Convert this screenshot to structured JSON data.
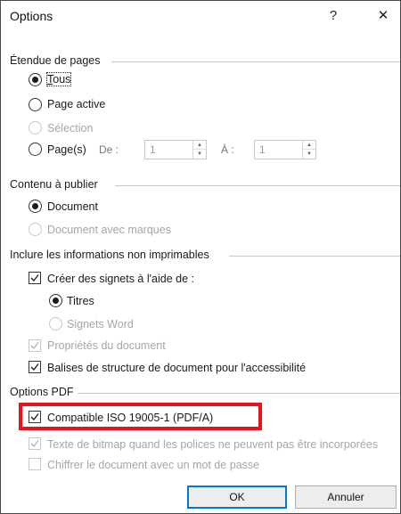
{
  "window": {
    "title": "Options",
    "help_glyph": "?",
    "close_glyph": "✕"
  },
  "page_range": {
    "title": "Étendue de pages",
    "all": "Tous",
    "current_page": "Page active",
    "selection": "Sélection",
    "pages": "Page(s)",
    "from_label": "De :",
    "from_value": "1",
    "to_label": "À :",
    "to_value": "1"
  },
  "publish_what": {
    "title": "Contenu à publier",
    "document": "Document",
    "document_markup": "Document avec marques"
  },
  "non_printing": {
    "title": "Inclure les informations non imprimables",
    "create_bookmarks": "Créer des signets à l'aide de :",
    "headings": "Titres",
    "word_bookmarks": "Signets Word",
    "doc_properties": "Propriétés du document",
    "structure_tags": "Balises de structure de document pour l'accessibilité"
  },
  "pdf_options": {
    "title": "Options PDF",
    "iso_compliant": "Compatible ISO 19005-1 (PDF/A)",
    "bitmap_text": "Texte de bitmap quand les polices ne peuvent pas être incorporées",
    "encrypt": "Chiffrer le document avec un mot de passe"
  },
  "footer": {
    "ok": "OK",
    "cancel": "Annuler"
  },
  "colors": {
    "highlight": "#e8131b",
    "accent": "#0078d7",
    "disabled_text": "#a6a6a6"
  }
}
